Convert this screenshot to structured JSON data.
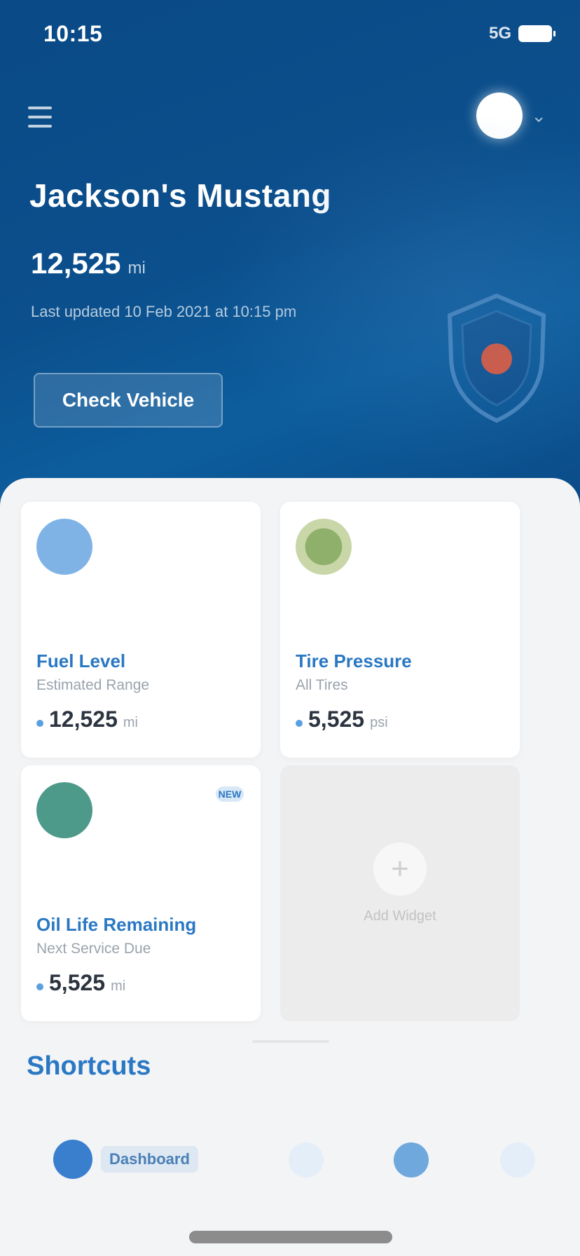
{
  "status_bar": {
    "time": "10:15",
    "network": "5G"
  },
  "header": {
    "vehicle_name": "Jackson's Mustang",
    "mileage_value": "12,525",
    "mileage_unit": "mi",
    "updated_text": "Last updated 10 Feb 2021 at 10:15 pm",
    "primary_button": "Check Vehicle"
  },
  "cards": [
    {
      "title": "Fuel Level",
      "subtitle": "Estimated Range",
      "value": "12,525",
      "unit": "mi",
      "icon": "fuel-icon",
      "color": "#7fb3e6"
    },
    {
      "title": "Tire Pressure",
      "subtitle": "All Tires",
      "value": "5,525",
      "unit": "psi",
      "icon": "tire-icon",
      "color": "#8fb06a"
    },
    {
      "title": "Oil Life Remaining",
      "subtitle": "Next Service Due",
      "value": "5,525",
      "unit": "mi",
      "icon": "oil-icon",
      "badge": "NEW",
      "color": "#4e9a8a"
    },
    {
      "add_label": "Add Widget",
      "icon": "plus-icon"
    }
  ],
  "section": {
    "title": "Shortcuts"
  },
  "tabs": [
    {
      "label": "Dashboard",
      "icon": "dashboard-icon"
    },
    {
      "label": "",
      "icon": "vehicle-icon"
    },
    {
      "label": "",
      "icon": "location-icon"
    },
    {
      "label": "",
      "icon": "account-icon"
    }
  ],
  "colors": {
    "hero": "#0b4f8c",
    "accent": "#2a78c4",
    "alert": "#e0573a"
  }
}
